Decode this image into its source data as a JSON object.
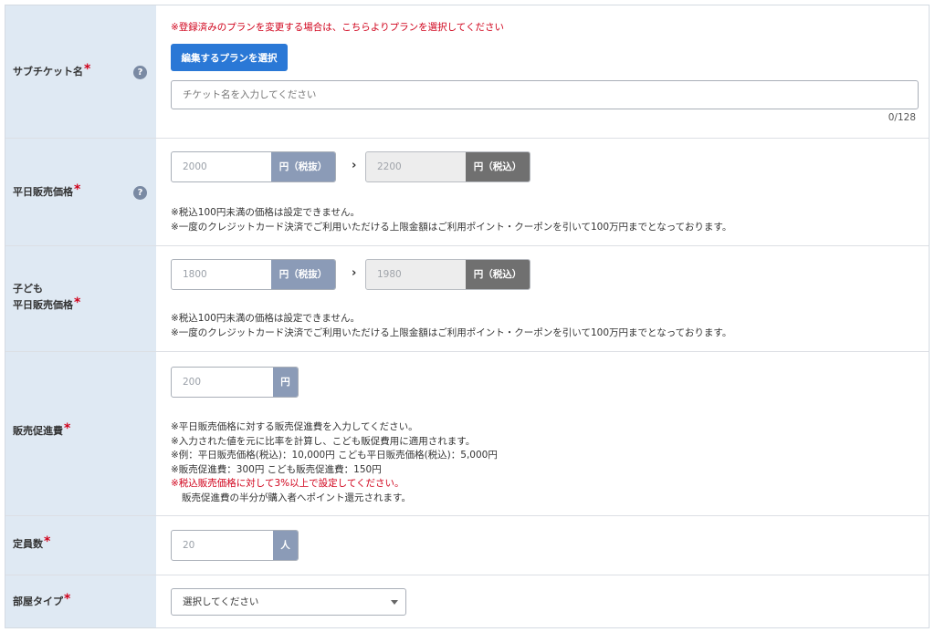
{
  "rows": {
    "subticket": {
      "label": "サブチケット名",
      "required_mark": "*",
      "help_icon": "question-circle-icon",
      "change_note": "※登録済みのプランを変更する場合は、こちらよりプランを選択してください",
      "select_plan_button": "編集するプランを選択",
      "name_placeholder": "チケット名を入力してください",
      "name_value": "",
      "counter": "0/128"
    },
    "weekday_price": {
      "label": "平日販売価格",
      "required_mark": "*",
      "help_icon": "question-circle-icon",
      "price_excl": "2000",
      "excl_unit": "円（税抜）",
      "arrow": "›",
      "price_incl": "2200",
      "incl_unit": "円（税込）",
      "notes": [
        "※税込100円未満の価格は設定できません。",
        "※一度のクレジットカード決済でご利用いただける上限金額はご利用ポイント・クーポンを引いて100万円までとなっております。"
      ]
    },
    "child_price": {
      "label_line1": "子ども",
      "label_line2": "平日販売価格",
      "required_mark": "*",
      "price_excl": "1800",
      "excl_unit": "円（税抜）",
      "arrow": "›",
      "price_incl": "1980",
      "incl_unit": "円（税込）",
      "notes": [
        "※税込100円未満の価格は設定できません。",
        "※一度のクレジットカード決済でご利用いただける上限金額はご利用ポイント・クーポンを引いて100万円までとなっております。"
      ]
    },
    "promo_fee": {
      "label": "販売促進費",
      "required_mark": "*",
      "value": "200",
      "unit": "円",
      "notes": [
        "※平日販売価格に対する販売促進費を入力してください。",
        "※入力された値を元に比率を計算し、こども販促費用に適用されます。",
        "※例：平日販売価格(税込)：10,000円 こども平日販売価格(税込)：5,000円",
        "※販売促進費：300円 こども販売促進費：150円"
      ],
      "red_note": "※税込販売価格に対して3%以上で設定してください。",
      "indent_note": "販売促進費の半分が購入者へポイント還元されます。"
    },
    "capacity": {
      "label": "定員数",
      "required_mark": "*",
      "value": "20",
      "unit": "人"
    },
    "room_type": {
      "label": "部屋タイプ",
      "required_mark": "*",
      "selected": "選択してください",
      "caret_icon": "caret-down-icon"
    }
  },
  "colors": {
    "label_bg": "#dfe9f3",
    "addon_blue": "#8b9bb7",
    "addon_dark": "#707070",
    "primary": "#2a78d6",
    "required": "#d0021b"
  }
}
